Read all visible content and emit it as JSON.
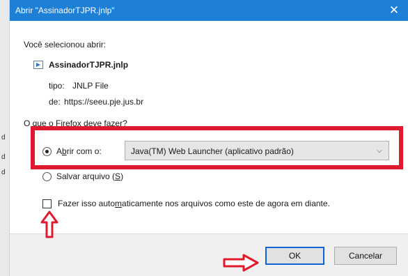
{
  "window": {
    "title": "Abrir \"AssinadorTJPR.jnlp\"",
    "close_glyph": "✕"
  },
  "background_strip": {
    "chars": [
      "d",
      "d",
      "d"
    ]
  },
  "dialog": {
    "intro": "Você selecionou abrir:",
    "file": {
      "name": "AssinadorTJPR.jnlp",
      "tipo_label": "tipo:",
      "tipo_value": "JNLP File",
      "de_label": "de:",
      "de_value": "https://seeu.pje.jus.br"
    },
    "question": "O que o Firefox deve fazer?",
    "open_with": {
      "label_pre": "A",
      "label_accel": "b",
      "label_post": "rir com o:",
      "selected": true,
      "app": "Java(TM) Web Launcher (aplicativo padrão)"
    },
    "save_file": {
      "label_pre": "Salvar arquivo (",
      "label_accel": "S",
      "label_post": ")",
      "selected": false
    },
    "auto": {
      "label_pre": "Fazer isso auto",
      "label_accel": "m",
      "label_post": "aticamente nos arquivos como este de agora em diante.",
      "checked": false
    },
    "buttons": {
      "ok": "OK",
      "cancel": "Cancelar"
    }
  },
  "colors": {
    "titlebar": "#1e7fd6",
    "annotation_red": "#e01a2e",
    "ok_focus_border": "#0a64d6"
  }
}
